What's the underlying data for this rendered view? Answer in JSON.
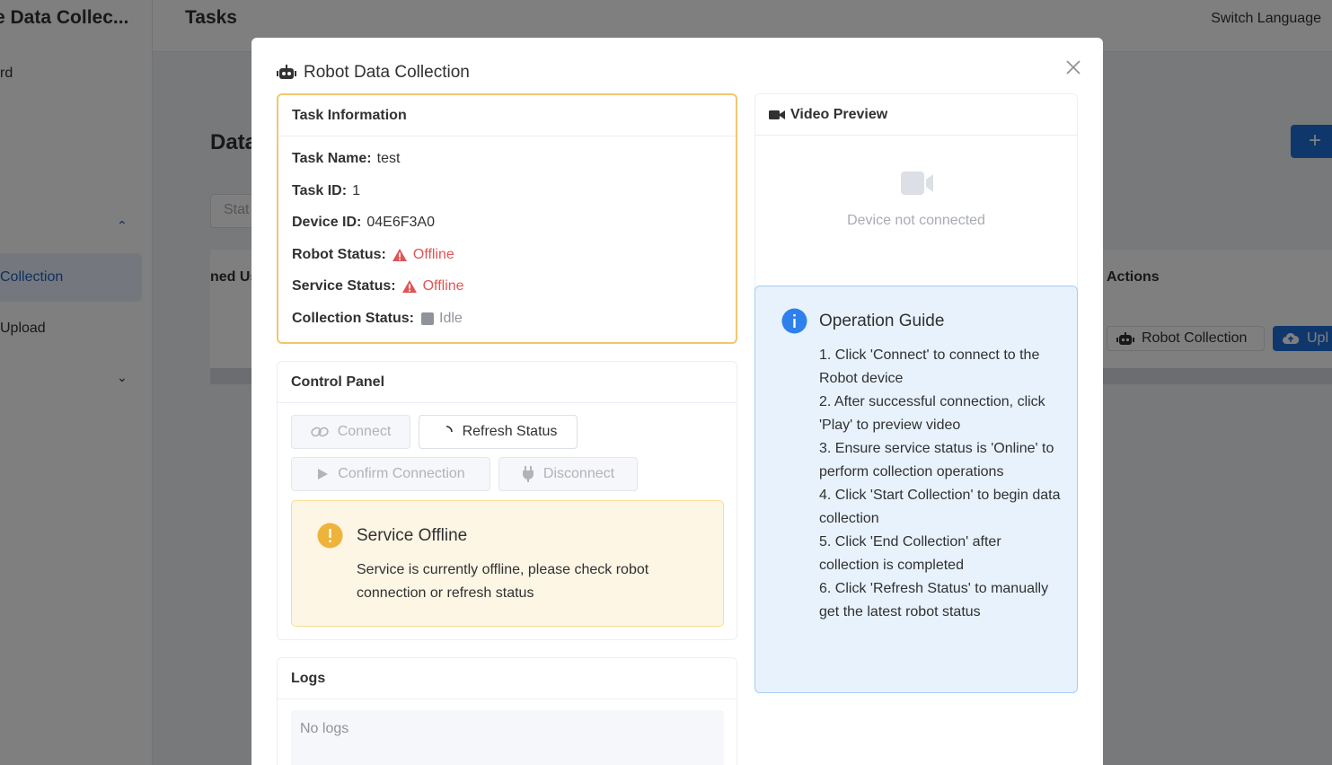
{
  "background": {
    "app_title": "e Data Collec...",
    "nav_partial_item": "rd",
    "nav_collection": "Collection",
    "nav_upload": "Upload",
    "page_header": "Tasks",
    "switch_language": "Switch Language",
    "main_title_partial": "Data",
    "filter_placeholder_partial": "Stat",
    "col_partial": "ned Us",
    "col_actions": "Actions",
    "robot_collection_btn": "Robot Collection",
    "upload_btn_partial": "Upl",
    "add_btn": "+"
  },
  "dialog": {
    "title": "Robot Data Collection",
    "task_info": {
      "header": "Task Information",
      "task_name_label": "Task Name:",
      "task_name": "test",
      "task_id_label": "Task ID:",
      "task_id": "1",
      "device_id_label": "Device ID:",
      "device_id": "04E6F3A0",
      "robot_status_label": "Robot Status:",
      "robot_status": "Offline",
      "service_status_label": "Service Status:",
      "service_status": "Offline",
      "collection_status_label": "Collection Status:",
      "collection_status": "Idle"
    },
    "video": {
      "header": "Video Preview",
      "empty_text": "Device not connected"
    },
    "control": {
      "header": "Control Panel",
      "connect": "Connect",
      "refresh": "Refresh Status",
      "confirm": "Confirm Connection",
      "disconnect": "Disconnect",
      "warning_title": "Service Offline",
      "warning_text": "Service is currently offline, please check robot connection or refresh status"
    },
    "guide": {
      "title": "Operation Guide",
      "steps": [
        "1. Click 'Connect' to connect to the Robot device",
        "2. After successful connection, click 'Play' to preview video",
        "3. Ensure service status is 'Online' to perform collection operations",
        "4. Click 'Start Collection' to begin data collection",
        "5. Click 'End Collection' after collection is completed",
        "6. Click 'Refresh Status' to manually get the latest robot status"
      ]
    },
    "logs": {
      "header": "Logs",
      "empty_text": "No logs"
    }
  },
  "colors": {
    "primary": "#1f6fd8",
    "danger": "#e05454",
    "warning": "#eeb33b",
    "highlight_border": "#f1c76d",
    "info_bg": "#e8f2fc"
  }
}
